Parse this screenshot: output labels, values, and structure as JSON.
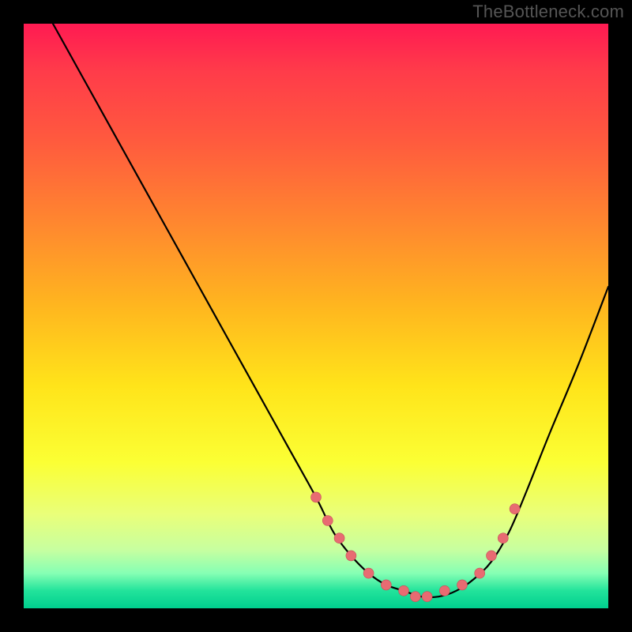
{
  "watermark": "TheBottleneck.com",
  "colors": {
    "background": "#000000",
    "curve": "#000000",
    "marker_fill": "#e86b72",
    "marker_stroke": "#c55158",
    "gradient_stops": [
      "#ff1a52",
      "#ff5a3e",
      "#ffb51f",
      "#ffe41a",
      "#e9ff7a",
      "#22e39b",
      "#00cf8e"
    ]
  },
  "chart_data": {
    "type": "line",
    "title": "",
    "xlabel": "",
    "ylabel": "",
    "xlim": [
      0,
      100
    ],
    "ylim": [
      0,
      100
    ],
    "grid": false,
    "series": [
      {
        "name": "curve",
        "x": [
          5,
          10,
          15,
          20,
          25,
          30,
          35,
          40,
          45,
          50,
          53,
          56,
          59,
          62,
          65,
          68,
          71,
          74,
          77,
          80,
          83,
          86,
          90,
          95,
          100
        ],
        "y": [
          100,
          91,
          82,
          73,
          64,
          55,
          46,
          37,
          28,
          19,
          13,
          9,
          6,
          4,
          3,
          2,
          2,
          3,
          5,
          8,
          13,
          20,
          30,
          42,
          55
        ]
      }
    ],
    "markers": {
      "name": "highlight-points",
      "x": [
        50,
        52,
        54,
        56,
        59,
        62,
        65,
        67,
        69,
        72,
        75,
        78,
        80,
        82,
        84
      ],
      "y": [
        19,
        15,
        12,
        9,
        6,
        4,
        3,
        2,
        2,
        3,
        4,
        6,
        9,
        12,
        17
      ]
    }
  }
}
